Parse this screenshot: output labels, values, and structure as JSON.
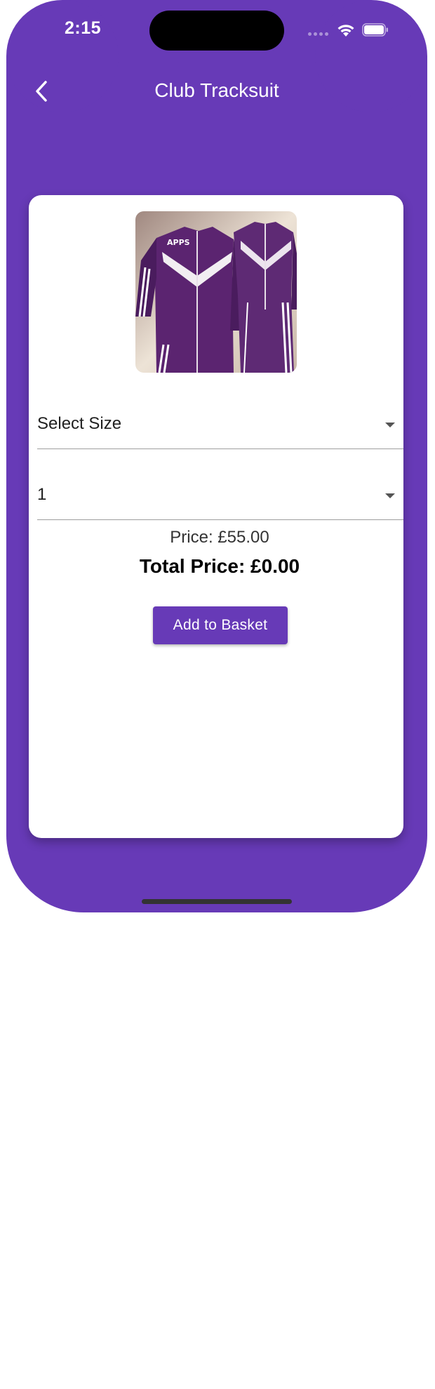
{
  "status_bar": {
    "time": "2:15",
    "icons": [
      "signal-dots-icon",
      "wifi-icon",
      "battery-icon"
    ]
  },
  "app_bar": {
    "back_icon": "chevron-left-icon",
    "title": "Club Tracksuit"
  },
  "product": {
    "image_icon": "tracksuit-image",
    "image_text": "APPS"
  },
  "size_dropdown": {
    "value": "Select Size"
  },
  "quantity_dropdown": {
    "value": "1"
  },
  "price": {
    "label": "Price: £55.00",
    "total_label": "Total Price: £0.00"
  },
  "actions": {
    "add_to_basket": "Add to Basket"
  },
  "colors": {
    "primary": "#673AB7",
    "card": "#FFFFFF",
    "text": "#212121"
  }
}
